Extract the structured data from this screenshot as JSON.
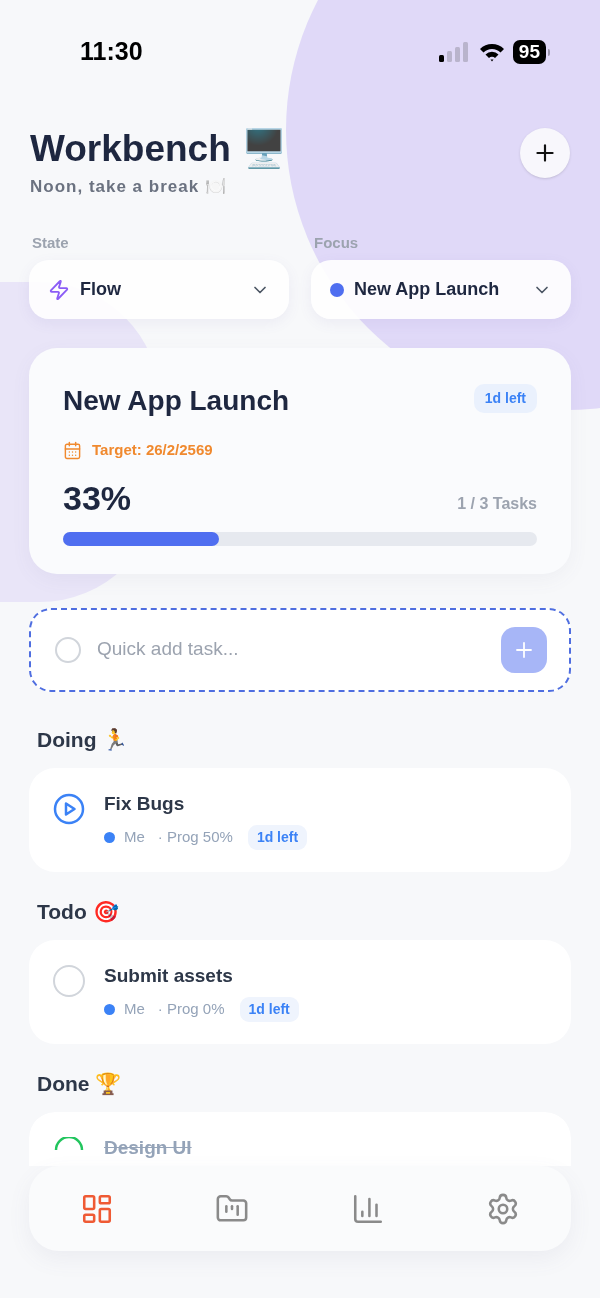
{
  "status_bar": {
    "time": "11:30",
    "battery": "95"
  },
  "header": {
    "title": "Workbench 🖥️",
    "subtitle": "Noon, take a break 🍽️"
  },
  "selectors": [
    {
      "label": "State",
      "value": "Flow",
      "kind": "state"
    },
    {
      "label": "Focus",
      "value": "New App Launch",
      "kind": "project",
      "color": "#4f6ef0"
    }
  ],
  "project_card": {
    "title": "New App Launch",
    "badge": "1d left",
    "target": "Target: 26/2/2569",
    "percent": "33%",
    "tasks": "1 / 3 Tasks",
    "level": 0.33
  },
  "quick_add": {
    "placeholder": "Quick add task...",
    "checked": false
  },
  "sections": [
    {
      "title": "Doing 🏃",
      "tasks": [
        {
          "kind": "doing",
          "checked": false,
          "title": "Fix Bugs",
          "assignee": "Me",
          "color": "#3b82f6",
          "progress": "· Prog 50%",
          "badge": "1d left"
        }
      ]
    },
    {
      "title": "Todo 🎯",
      "tasks": [
        {
          "kind": "todo",
          "checked": false,
          "title": "Submit assets",
          "assignee": "Me",
          "color": "#3b82f6",
          "progress": "· Prog 0%",
          "badge": "1d left"
        }
      ]
    },
    {
      "title": "Done 🏆",
      "tasks": [
        {
          "kind": "done",
          "checked": true,
          "title": "Design UI"
        }
      ]
    }
  ],
  "nav": [
    {
      "kind": "dashboard",
      "selected": true
    },
    {
      "kind": "projects",
      "selected": false
    },
    {
      "kind": "stats",
      "selected": false
    },
    {
      "kind": "settings",
      "selected": false
    }
  ]
}
